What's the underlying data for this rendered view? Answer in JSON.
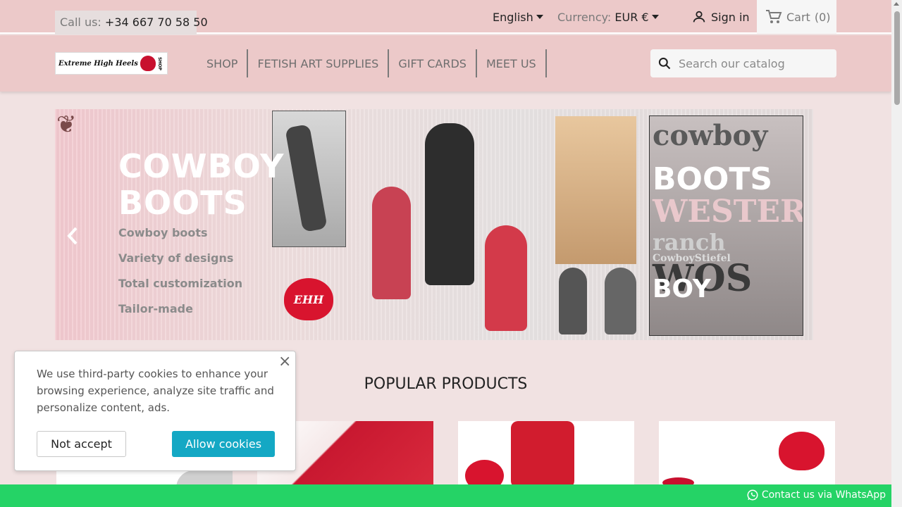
{
  "topbar": {
    "call_label": "Call us:",
    "call_number": "+34 667 70 58 50",
    "language": "English",
    "currency_label": "Currency:",
    "currency_value": "EUR €",
    "signin": "Sign in",
    "cart": "Cart",
    "cart_count": "(0)"
  },
  "header": {
    "logo_text": "Extreme High Heels",
    "logo_shop": "SHOP",
    "nav": [
      {
        "label": "SHOP"
      },
      {
        "label": "FETISH ART SUPPLIES"
      },
      {
        "label": "GIFT CARDS"
      },
      {
        "label": "MEET US"
      }
    ],
    "search_placeholder": "Search our catalog"
  },
  "carousel": {
    "title_line1": "COWBOY",
    "title_line2": "BOOTS",
    "bullets": [
      "Cowboy boots",
      "Variety of designs",
      "Total customization",
      "Tailor-made"
    ],
    "logo_mark": "EHH",
    "sign_words": [
      "cowboy",
      "BOOTS",
      "WESTERN",
      "ranch",
      "CowboyStiefel",
      "WOS",
      "BOY"
    ]
  },
  "section": {
    "popular_title": "POPULAR PRODUCTS"
  },
  "cookie": {
    "text": "We use third-party cookies to enhance your browsing experience, analyze site traffic and personalize content, ads.",
    "decline": "Not accept",
    "accept": "Allow cookies",
    "close": "×"
  },
  "whatsapp": {
    "label": "Contact us via WhatsApp"
  },
  "colors": {
    "header_bg": "#ecc9c9",
    "accent": "#14a8c4",
    "whatsapp_green": "#25d366"
  }
}
